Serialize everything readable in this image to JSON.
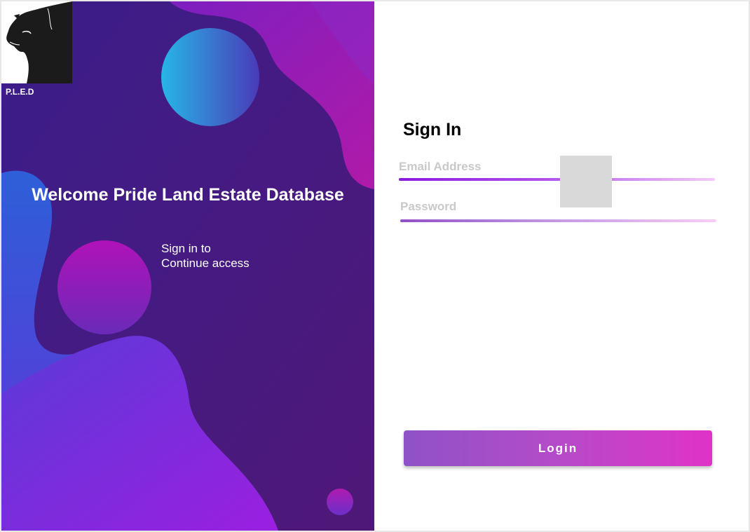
{
  "brand": {
    "logo": "panther-logo",
    "name": "P.L.E.D"
  },
  "left_panel": {
    "welcome_title": "Welcome Pride Land Estate Database",
    "subtitle_line1": "Sign in to",
    "subtitle_line2": "Continue access"
  },
  "form": {
    "title": "Sign In",
    "email_placeholder": "Email Address",
    "password_placeholder": "Password",
    "login_label": "Login"
  },
  "colors": {
    "panel_background": "#3d1c84",
    "accent_purple": "#8a1be0",
    "accent_magenta": "#e032c8",
    "placeholder_gray": "#c9c9c9"
  }
}
